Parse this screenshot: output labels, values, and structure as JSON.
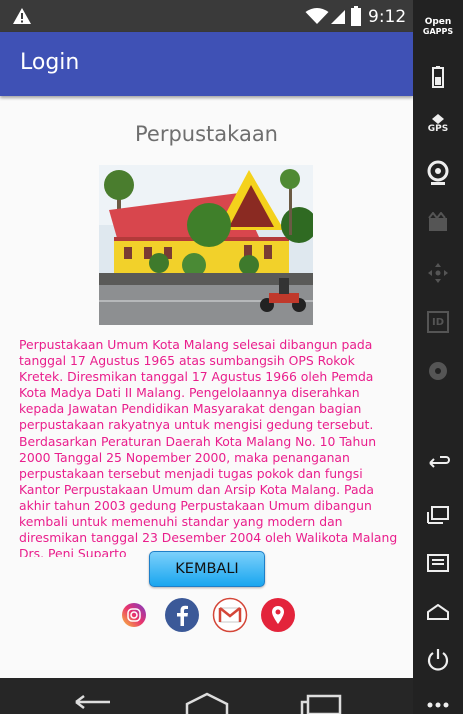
{
  "status_bar": {
    "time": "9:12"
  },
  "app_bar": {
    "title": "Login"
  },
  "content": {
    "heading": "Perpustakaan",
    "description": "Perpustakaan Umum Kota Malang selesai dibangun pada tanggal 17 Agustus 1965 atas sumbangsih OPS Rokok Kretek. Diresmikan tanggal 17 Agustus 1966 oleh Pemda Kota Madya Dati II Malang. Pengelolaannya diserahkan kepada Jawatan Pendidikan Masyarakat dengan bagian perpustakaan rakyatnya untuk mengisi gedung tersebut. Berdasarkan Peraturan Daerah Kota Malang No. 10 Tahun 2000 Tanggal 25 Nopember 2000, maka penanganan perpustakaan tersebut menjadi tugas pokok dan fungsi Kantor Perpustakaan Umum dan Arsip Kota Malang. Pada akhir tahun 2003 gedung Perpustakaan Umum dibangun kembali untuk memenuhi standar yang modern dan diresmikan tanggal 23 Desember 2004 oleh Walikota Malang Drs. Peni Suparto",
    "back_button": "KEMBALI",
    "text_color": "#e91e8c"
  },
  "social_icons": [
    "instagram-icon",
    "facebook-icon",
    "gmail-icon",
    "location-pin-icon"
  ],
  "side_panel": {
    "brand_line1": "Open",
    "brand_line2": "GAPPS",
    "gps_label": "GPS",
    "id_label": "ID"
  },
  "colors": {
    "app_bar": "#3f51b5",
    "button": "#19a6ef"
  }
}
